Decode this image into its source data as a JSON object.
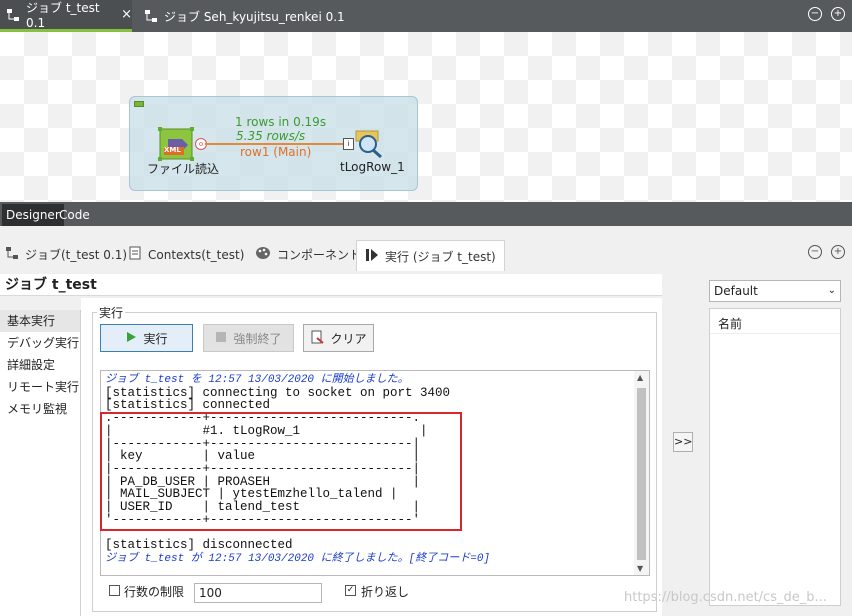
{
  "editor_tabs": [
    {
      "label": "ジョブ t_test 0.1",
      "active": true
    },
    {
      "label": "ジョブ Seh_kyujitsu_renkei 0.1",
      "active": false
    }
  ],
  "canvas": {
    "source_component": "ファイル読込",
    "source_badge": "XML",
    "target_component": "tLogRow_1",
    "flow_rows": "1 rows in 0.19s",
    "flow_rate": "5.35 rows/s",
    "flow_label": "row1 (Main)"
  },
  "designer_tabs": [
    {
      "label": "Designer",
      "active": true
    },
    {
      "label": "Code",
      "active": false
    }
  ],
  "view_tabs": [
    {
      "label": "ジョブ(t_test 0.1)"
    },
    {
      "label": "Contexts(t_test)"
    },
    {
      "label": "コンポーネント"
    },
    {
      "label": "実行 (ジョブ t_test)",
      "active": true
    }
  ],
  "job_title": "ジョブ t_test",
  "left_nav": [
    "基本実行",
    "デバッグ実行",
    "詳細設定",
    "リモート実行",
    "メモリ監視"
  ],
  "group_label": "実行",
  "buttons": {
    "run": "実行",
    "kill": "強制終了",
    "clear": "クリア"
  },
  "console": {
    "line1": "ジョブ t_test を 12:57 13/03/2020 に開始しました。",
    "line2": "[statistics] connecting to socket on port 3400",
    "line3": "[statistics] connected",
    "table": ".------------+---------------------------.\n|            #1. tLogRow_1                |\n|------------+---------------------------|\n| key        | value                     |\n|------------+---------------------------|\n| PA_DB_USER | PROASEH                   |\n| MAIL_SUBJECT | ytestEmzhello_talend |\n| USER_ID    | talend_test               |\n'------------+---------------------------'",
    "line4": "[statistics] disconnected",
    "line5": "ジョブ t_test が 12:57 13/03/2020 に終了しました。[終了コード=0]"
  },
  "limit_label": "行数の制限",
  "limit_value": "100",
  "wrap_label": "折り返し",
  "right": {
    "select": "Default",
    "column_header": "名前",
    "arrow": ">>"
  },
  "watermark": "https://blog.csdn.net/cs_de_b..."
}
